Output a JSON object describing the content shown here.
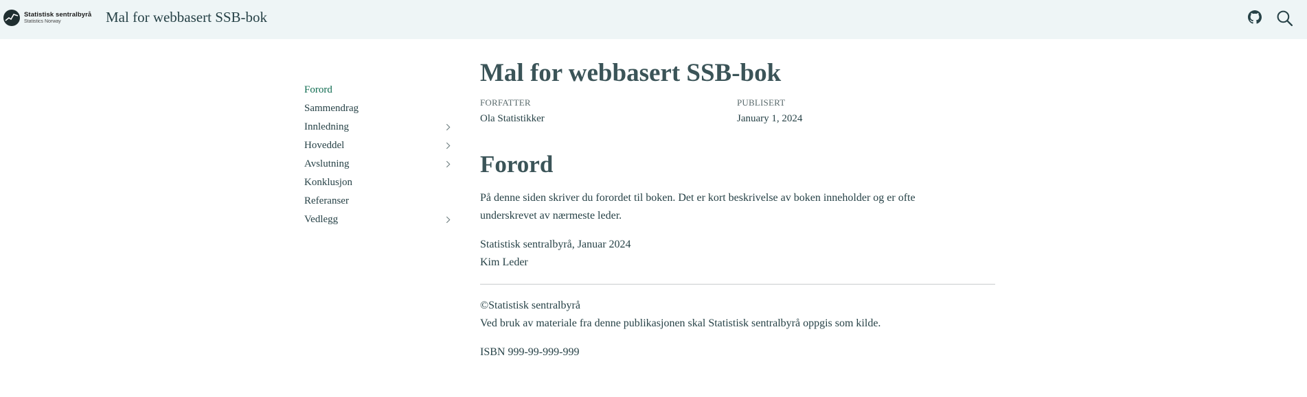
{
  "header": {
    "logo_line1": "Statistisk sentralbyrå",
    "logo_line2": "Statistics Norway",
    "title": "Mal for webbasert SSB-bok"
  },
  "icons": {
    "github": "github-icon",
    "search": "search-icon",
    "chevron": "chevron-right-icon"
  },
  "sidebar": {
    "items": [
      {
        "label": "Forord",
        "active": true,
        "expandable": false
      },
      {
        "label": "Sammendrag",
        "active": false,
        "expandable": false
      },
      {
        "label": "Innledning",
        "active": false,
        "expandable": true
      },
      {
        "label": "Hoveddel",
        "active": false,
        "expandable": true
      },
      {
        "label": "Avslutning",
        "active": false,
        "expandable": true
      },
      {
        "label": "Konklusjon",
        "active": false,
        "expandable": false
      },
      {
        "label": "Referanser",
        "active": false,
        "expandable": false
      },
      {
        "label": "Vedlegg",
        "active": false,
        "expandable": true
      }
    ]
  },
  "main": {
    "title": "Mal for webbasert SSB-bok",
    "meta": {
      "author_label": "FORFATTER",
      "author": "Ola Statistikker",
      "published_label": "PUBLISERT",
      "published": "January 1, 2024"
    },
    "section_title": "Forord",
    "intro": "På denne siden skriver du forordet til boken. Det er kort beskrivelse av boken inneholder og er ofte underskrevet av nærmeste leder.",
    "sign_place": "Statistisk sentralbyrå, Januar 2024",
    "sign_name": "Kim Leder",
    "copyright": "©Statistisk sentralbyrå",
    "usage": "Ved bruk av materiale fra denne publikasjonen skal Statistisk sentralbyrå oppgis som kilde.",
    "isbn": "ISBN 999-99-999-999"
  },
  "colors": {
    "header_bg": "#eef5f6",
    "text": "#274247",
    "active": "#0f6b50"
  }
}
